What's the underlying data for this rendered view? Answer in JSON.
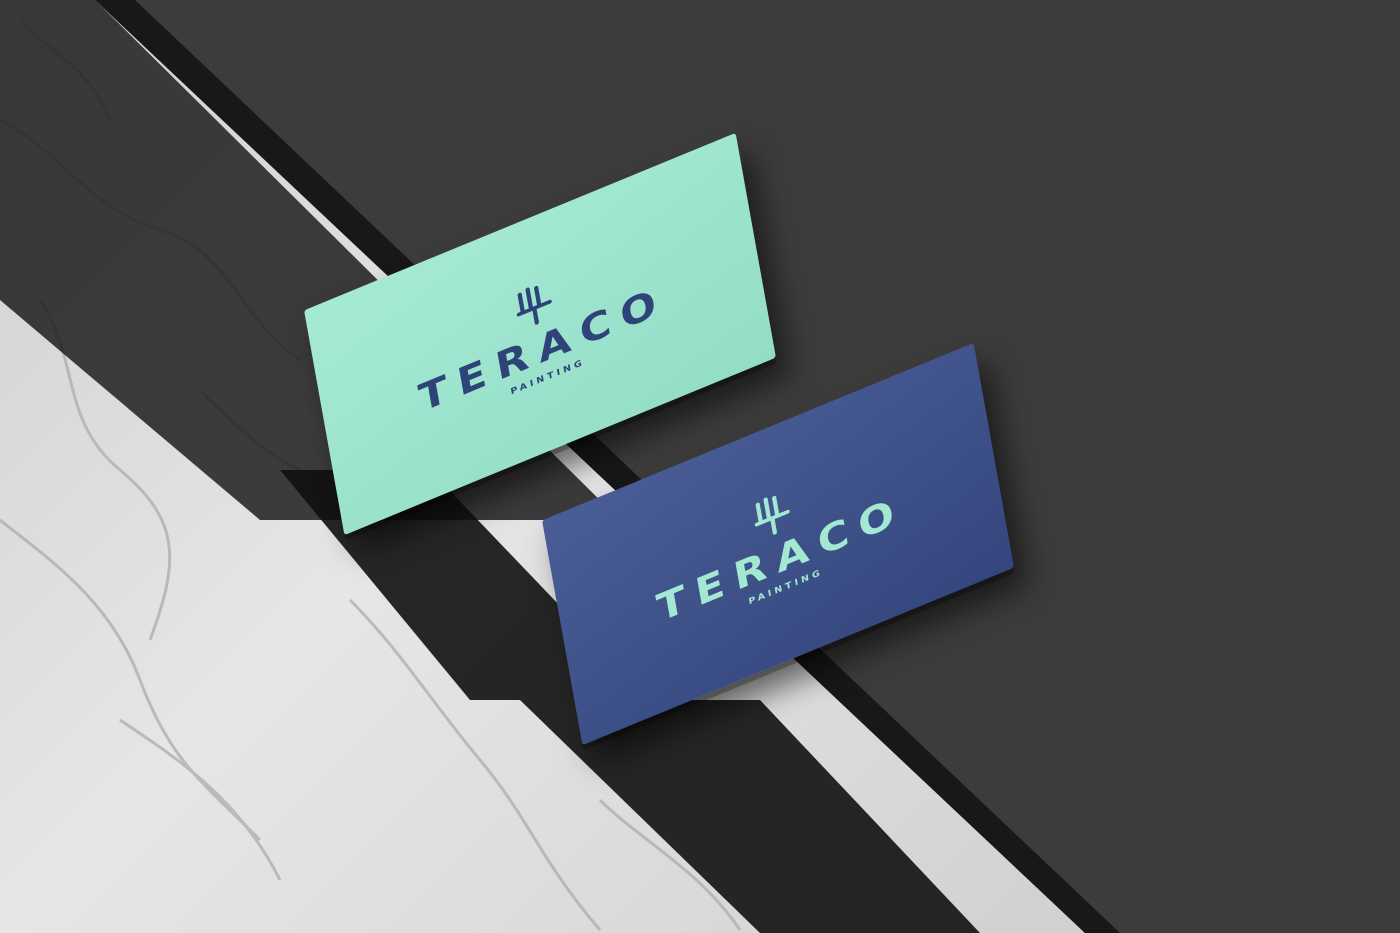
{
  "scene": {
    "colors": {
      "marble": "#dcdcdc",
      "stone": "#3a3a3a",
      "mint": "#9ee4cf",
      "navy": "#3c4f88"
    }
  },
  "cards": [
    {
      "brand": "TERACO",
      "tagline": "PAINTING",
      "icon": "paint-brush-icon",
      "background": "#9ee4cf",
      "text_color": "#2e4479"
    },
    {
      "brand": "TERACO",
      "tagline": "PAINTING",
      "icon": "paint-brush-icon",
      "background": "#3c4f88",
      "text_color": "#a2e8d2"
    }
  ]
}
